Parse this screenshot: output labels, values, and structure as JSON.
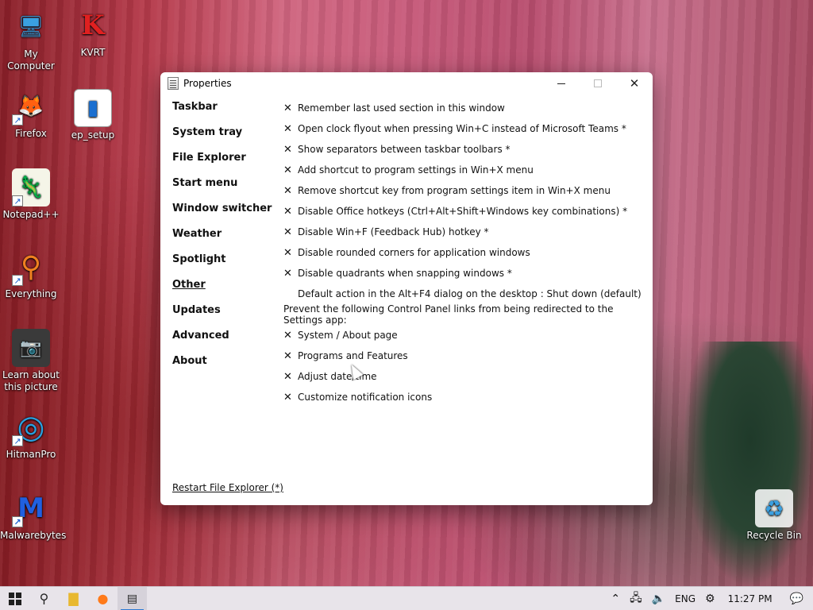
{
  "desktop": {
    "icons": [
      {
        "label": "My Computer",
        "glyph": "🖥",
        "color": "#3aa0e0"
      },
      {
        "label": "KVRT",
        "glyph": "K",
        "color": "#e02020"
      },
      {
        "label": "Firefox",
        "glyph": "🦊",
        "color": "#ff7a1a"
      },
      {
        "label": "ep_setup",
        "glyph": "▮",
        "color": "#1a6fd0"
      },
      {
        "label": "Notepad++",
        "glyph": "🦎",
        "color": "#8ac040"
      },
      {
        "label": "Everything",
        "glyph": "⚲",
        "color": "#f08020"
      },
      {
        "label": "Learn about this picture",
        "glyph": "📷",
        "color": "#333333"
      },
      {
        "label": "HitmanPro",
        "glyph": "◎",
        "color": "#2aa0e0"
      },
      {
        "label": "Malwarebytes",
        "glyph": "M",
        "color": "#2060e0"
      },
      {
        "label": "Recycle Bin",
        "glyph": "♻",
        "color": "#3aa0e0"
      }
    ]
  },
  "window": {
    "title": "Properties",
    "nav": [
      "Taskbar",
      "System tray",
      "File Explorer",
      "Start menu",
      "Window switcher",
      "Weather",
      "Spotlight",
      "Other",
      "Updates",
      "Advanced",
      "About"
    ],
    "active_nav": "Other",
    "options": [
      {
        "mark": "✕",
        "label": "Remember last used section in this window"
      },
      {
        "mark": "✕",
        "label": "Open clock flyout when pressing Win+C instead of Microsoft Teams *"
      },
      {
        "mark": "✕",
        "label": "Show separators between taskbar toolbars *"
      },
      {
        "mark": "✕",
        "label": "Add shortcut to program settings in Win+X menu"
      },
      {
        "mark": "✕",
        "label": "Remove shortcut key from program settings item in Win+X menu"
      },
      {
        "mark": "✕",
        "label": "Disable Office hotkeys (Ctrl+Alt+Shift+Windows key combinations) *"
      },
      {
        "mark": "✕",
        "label": "Disable Win+F (Feedback Hub) hotkey *"
      },
      {
        "mark": "✕",
        "label": "Disable rounded corners for application windows"
      },
      {
        "mark": "✕",
        "label": "Disable quadrants when snapping windows *"
      },
      {
        "mark": "",
        "label": "Default action in the Alt+F4 dialog on the desktop : Shut down (default)"
      }
    ],
    "section_heading": "Prevent the following Control Panel links from being redirected to the Settings app:",
    "redirect_options": [
      {
        "mark": "✕",
        "label": "System / About page"
      },
      {
        "mark": "✕",
        "label": "Programs and Features"
      },
      {
        "mark": "✕",
        "label": "Adjust date/time"
      },
      {
        "mark": "✕",
        "label": "Customize notification icons"
      }
    ],
    "restart_link": "Restart File Explorer (*)"
  },
  "taskbar": {
    "language": "ENG",
    "time": "11:27 PM",
    "accent": "#2b78d4"
  }
}
